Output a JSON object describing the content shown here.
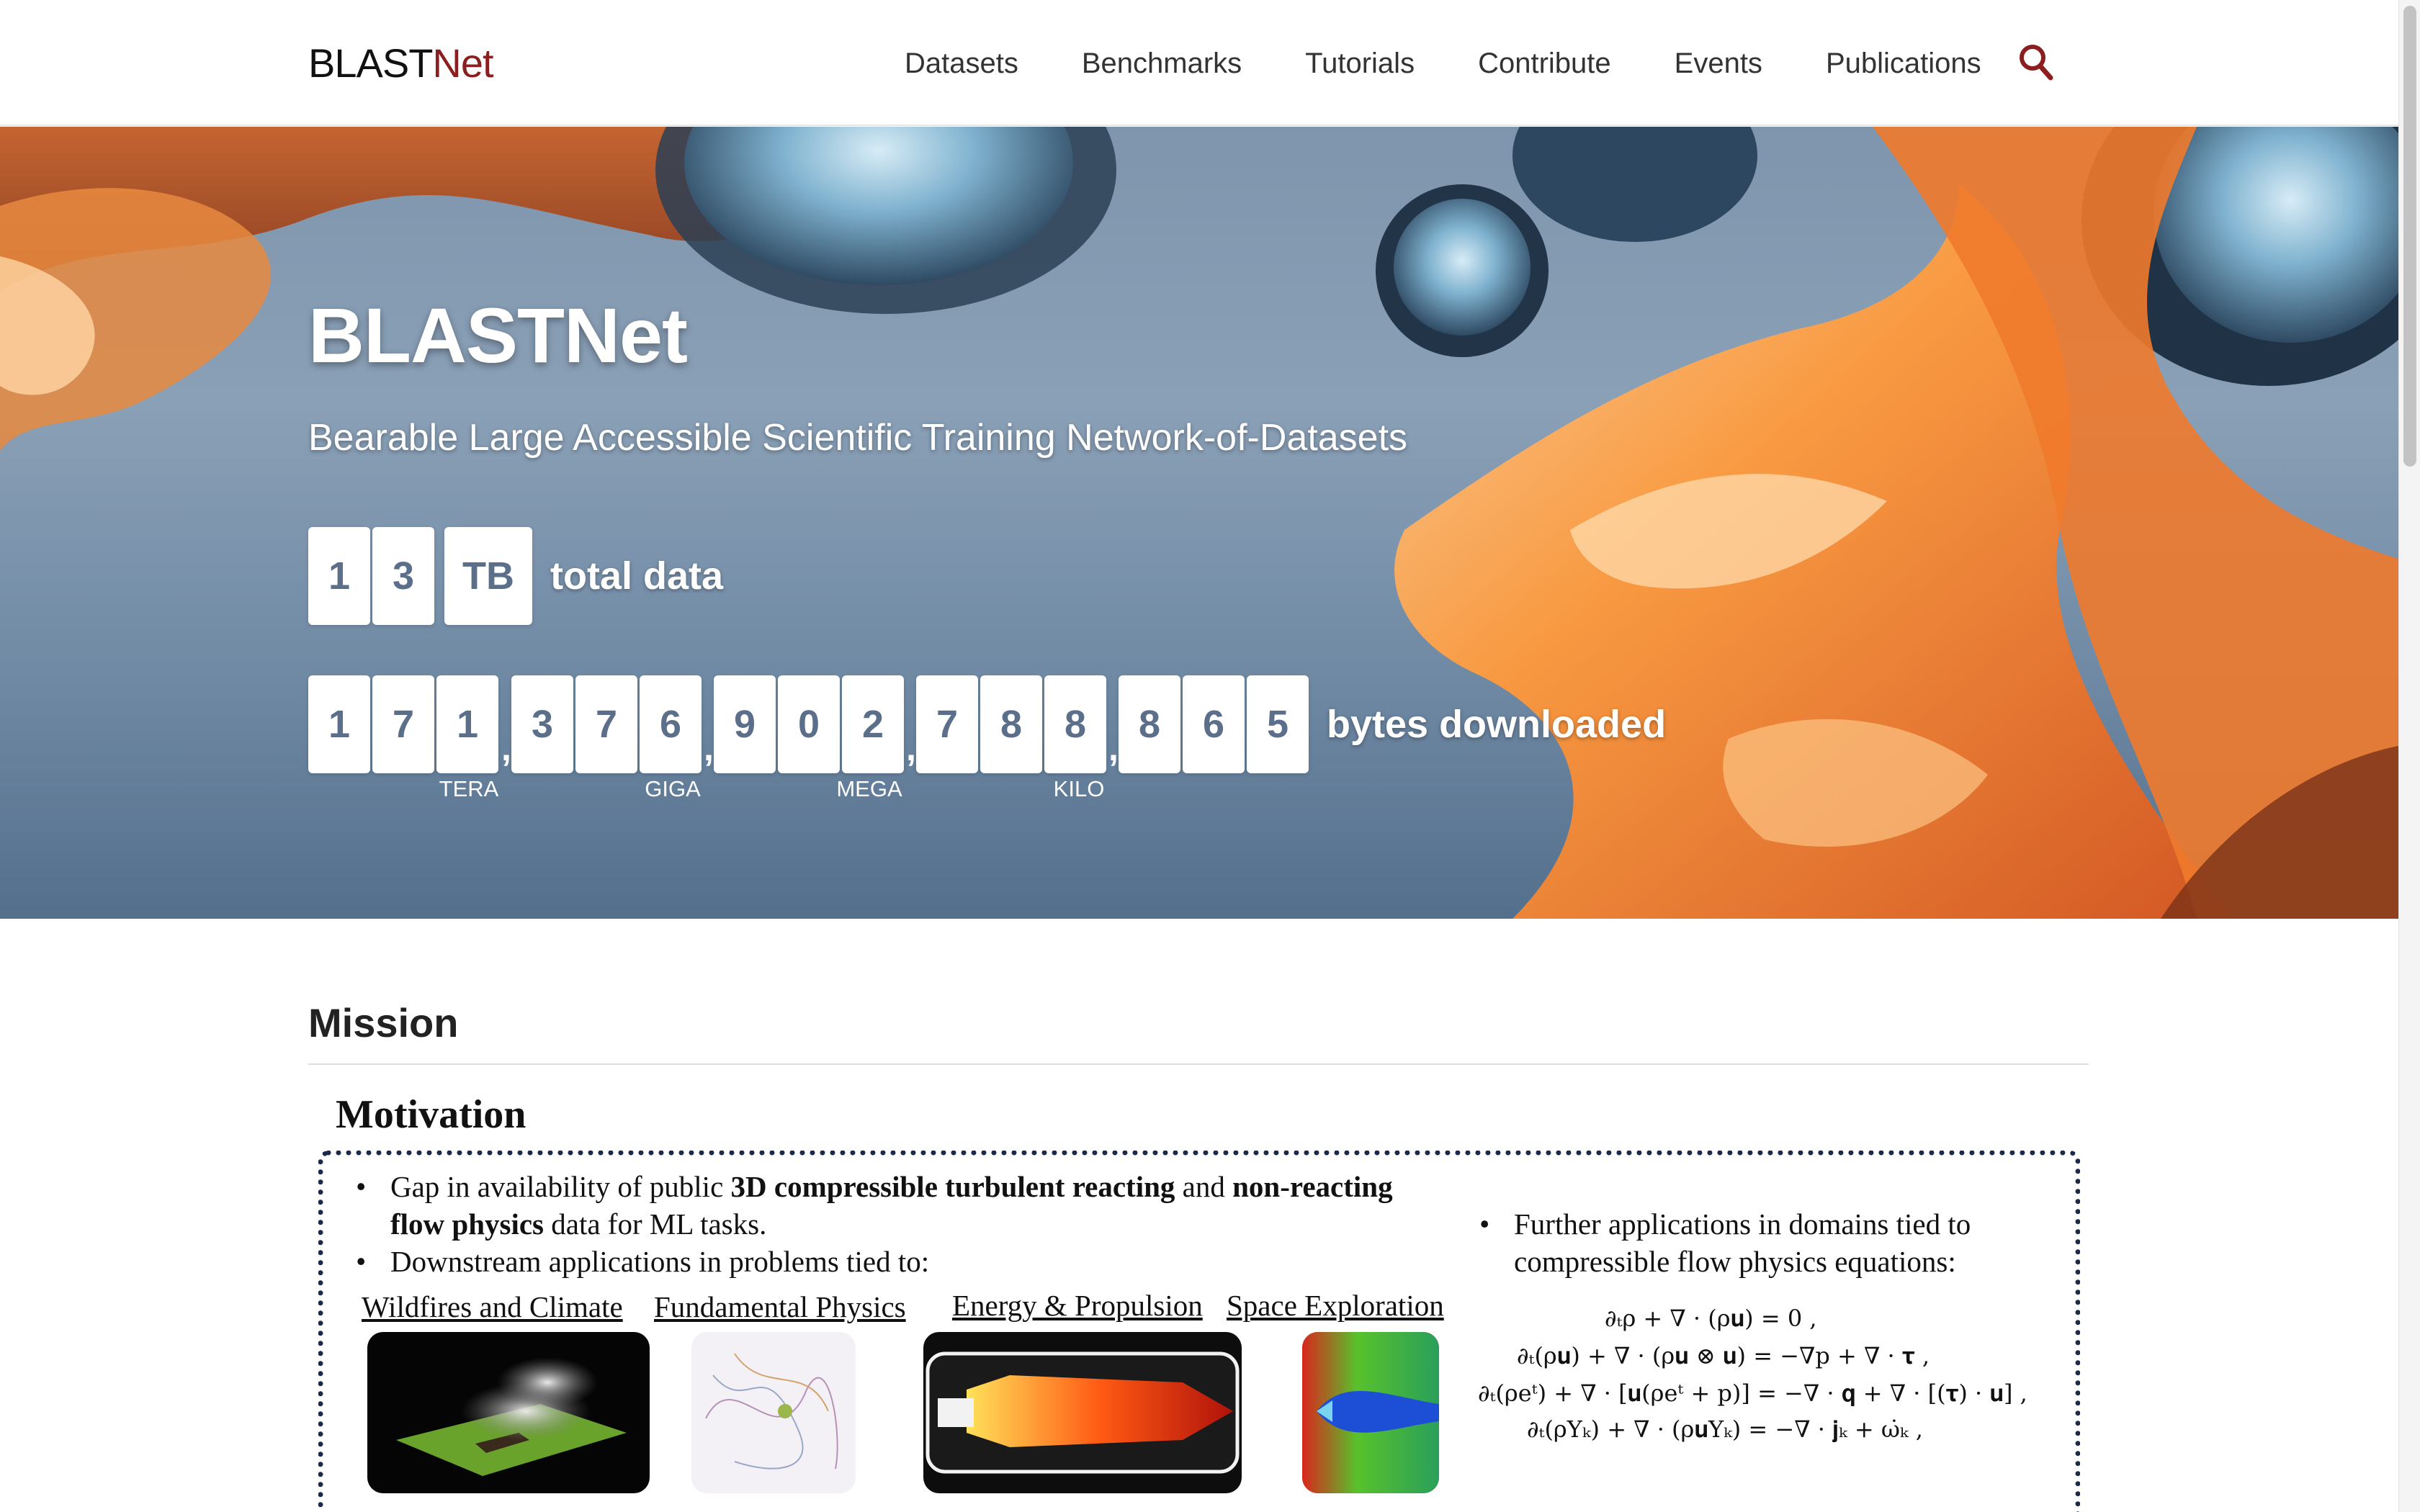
{
  "navbar": {
    "brand": {
      "prefix": "BLAST",
      "accent": "Net"
    },
    "links": [
      "Datasets",
      "Benchmarks",
      "Tutorials",
      "Contribute",
      "Events",
      "Publications"
    ],
    "search_icon": "search-icon",
    "accent_color": "#8b1e1e"
  },
  "hero": {
    "title": "BLASTNet",
    "subtitle": "Bearable Large Accessible Scientific Training Network-of-Datasets",
    "total_data": {
      "digits": [
        "1",
        "3"
      ],
      "unit": "TB",
      "label": "total data"
    },
    "downloads": {
      "digits": [
        "1",
        "7",
        "1",
        "3",
        "7",
        "6",
        "9",
        "0",
        "2",
        "7",
        "8",
        "8",
        "8",
        "6",
        "5"
      ],
      "separator": ",",
      "label": "bytes downloaded",
      "units": [
        "TERA",
        "GIGA",
        "MEGA",
        "KILO"
      ]
    },
    "tile_text_color": "#5b6f8b"
  },
  "mission": {
    "title": "Mission",
    "figure": {
      "title": "Motivation",
      "bullets": [
        {
          "parts": [
            "Gap in availability of public ",
            "3D compressible turbulent reacting",
            " and ",
            "non-reacting",
            "flow physics",
            " data for ML tasks."
          ]
        },
        {
          "text": "Downstream applications in problems tied to:"
        },
        {
          "text_line1": "Further applications in domains tied to",
          "text_line2": "compressible flow physics equations:"
        }
      ],
      "domains": [
        "Wildfires and Climate",
        "Fundamental Physics",
        "Energy & Propulsion",
        "Space Exploration"
      ],
      "equations": [
        "∂ₜρ + ∇ · (ρ𝐮) = 0 ,",
        "∂ₜ(ρ𝐮) + ∇ · (ρ𝐮 ⊗ 𝐮) = −∇p + ∇ · 𝛕 ,",
        "∂ₜ(ρeᵗ) + ∇ · [𝐮(ρeᵗ + p)] = −∇ · 𝐪 + ∇ · [(𝛕) · 𝐮] ,",
        "∂ₜ(ρYₖ) + ∇ · (ρ𝐮Yₖ) = −∇ · 𝐣ₖ + ω̇ₖ ,"
      ]
    }
  }
}
